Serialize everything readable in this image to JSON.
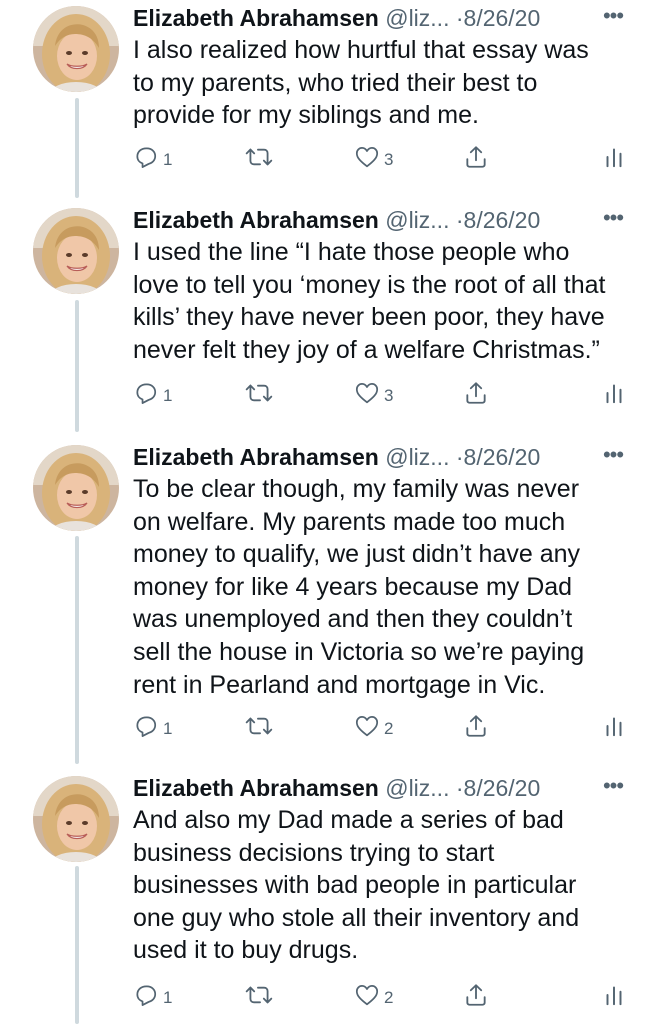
{
  "colors": {
    "text": "#0f1419",
    "secondary": "#536471",
    "thread_line": "#cfd9de",
    "avatar_bg": "#d8b79a"
  },
  "tweets": [
    {
      "name": "Elizabeth Abrahamsen",
      "handle": "@liz...",
      "separator": "·",
      "date": "8/26/20",
      "more": "•••",
      "text": "I also realized how hurtful that essay was\nto my parents, who tried their best to\nprovide for my siblings and me.",
      "replies": "1",
      "likes": "3"
    },
    {
      "name": "Elizabeth Abrahamsen",
      "handle": "@liz...",
      "separator": "·",
      "date": "8/26/20",
      "more": "•••",
      "text": "I used the line “I hate those people who\nlove to tell you ‘money is the root of all that\nkills’ they have never been poor, they have\nnever felt they joy of a welfare Christmas.”",
      "replies": "1",
      "likes": "3"
    },
    {
      "name": "Elizabeth Abrahamsen",
      "handle": "@liz...",
      "separator": "·",
      "date": "8/26/20",
      "more": "•••",
      "text": "To be clear though, my family was never\non welfare. My parents made too much\nmoney to qualify, we just didn’t have any\nmoney for like 4 years because my Dad\nwas unemployed and then they couldn’t\nsell the house in Victoria so we’re paying\nrent in Pearland and mortgage in Vic.",
      "replies": "1",
      "likes": "2"
    },
    {
      "name": "Elizabeth Abrahamsen",
      "handle": "@liz...",
      "separator": "·",
      "date": "8/26/20",
      "more": "•••",
      "text": "And also my Dad made a series of bad\nbusiness decisions trying to start\nbusinesses with bad people in particular\none guy who stole all their inventory and\nused it to buy drugs.",
      "replies": "1",
      "likes": "2"
    }
  ],
  "icons": {
    "reply": "reply-icon",
    "retweet": "retweet-icon",
    "like": "like-icon",
    "share": "share-icon",
    "analytics": "analytics-icon",
    "avatar": "avatar-photo"
  }
}
